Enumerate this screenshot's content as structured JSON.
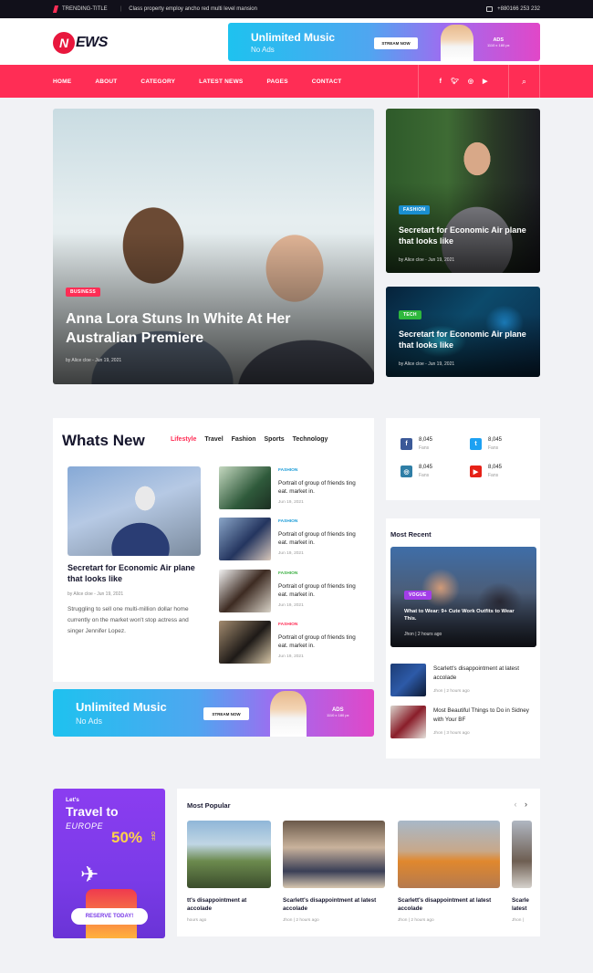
{
  "topbar": {
    "trending_label": "TRENDING-TITLE",
    "trending_text": "Class property employ ancho red multi level mansion",
    "phone": "+880166 253 232"
  },
  "logo": {
    "text": "EWS",
    "initial": "N"
  },
  "header_ad": {
    "title": "Unlimited Music",
    "subtitle": "No Ads",
    "button": "STREAM NOW",
    "ads_label": "ADS",
    "ads_size": "1110 x 180 px"
  },
  "nav": {
    "items": [
      "HOME",
      "ABOUT",
      "CATEGORY",
      "LATEST NEWS",
      "PAGES",
      "CONTACT"
    ],
    "social": [
      "f",
      "t",
      "ig",
      "yt"
    ],
    "search_icon": "search-icon"
  },
  "hero": {
    "main": {
      "badge": "BUSINESS",
      "title": "Anna Lora Stuns In White At Her Australian Premiere",
      "meta": "by Alice cloe - Jun 19, 2021"
    },
    "right1": {
      "badge": "FASHION",
      "title": "Secretart for Economic Air plane that looks like",
      "meta": "by Alice cloe - Jun 19, 2021"
    },
    "right2": {
      "badge": "TECH",
      "title": "Secretart for Economic Air plane that looks like",
      "meta": "by Alice cloe - Jun 19, 2021"
    }
  },
  "whats_new": {
    "heading": "Whats New",
    "tabs": [
      "Lifestyle",
      "Travel",
      "Fashion",
      "Sports",
      "Technology"
    ],
    "featured": {
      "title": "Secretart for Economic Air plane that looks like",
      "meta": "by Alice cloe - Jun 19, 2021",
      "excerpt": "Struggling to sell one multi-million dollar home currently on the market won't stop actress and singer Jennifer Lopez."
    },
    "items": [
      {
        "category": "FASHION",
        "title": "Portrait of group of friends ting eat. market in.",
        "meta": "Jun 19, 2021",
        "color": "#1a9bd7"
      },
      {
        "category": "FASHION",
        "title": "Portrait of group of friends ting eat. market in.",
        "meta": "Jun 19, 2021",
        "color": "#1a9bd7"
      },
      {
        "category": "FASHION",
        "title": "Portrait of group of friends ting eat. market in.",
        "meta": "Jun 19, 2021",
        "color": "#3cb043"
      },
      {
        "category": "FASHION",
        "title": "Portrait of group of friends ting eat. market in.",
        "meta": "Jun 19, 2021",
        "color": "#ff2d55"
      }
    ]
  },
  "fans": [
    {
      "icon": "facebook-icon",
      "glyph": "f",
      "value": "8,045",
      "label": "Fans",
      "color": "#3b5998"
    },
    {
      "icon": "twitter-icon",
      "glyph": "t",
      "value": "8,045",
      "label": "Fans",
      "color": "#1da1f2"
    },
    {
      "icon": "instagram-icon",
      "glyph": "◎",
      "value": "8,045",
      "label": "Fans",
      "color": "#2f7ea6"
    },
    {
      "icon": "youtube-icon",
      "glyph": "▶",
      "value": "8,045",
      "label": "Fans",
      "color": "#e62117"
    }
  ],
  "most_recent": {
    "heading": "Most Recent",
    "featured": {
      "badge": "VOGUE",
      "title": "What to Wear: 9+ Cute Work Outfits to Wear This.",
      "meta": "Jhon | 2 hours ago"
    },
    "items": [
      {
        "title": "Scarlett's disappointment at latest accolade",
        "meta": "Jhon | 2 hours ago"
      },
      {
        "title": "Most Beautiful Things to Do in Sidney with Your BF",
        "meta": "Jhon | 3 hours ago"
      }
    ]
  },
  "mid_ad": {
    "title": "Unlimited Music",
    "subtitle": "No Ads",
    "button": "STREAM NOW",
    "ads_label": "ADS",
    "ads_size": "1110 x 180 px"
  },
  "promo": {
    "lets": "Let's",
    "travel": "Travel to",
    "europe": "EUROPE",
    "percent": "50%",
    "off": "OFF",
    "button": "RESERVE TODAY!"
  },
  "most_popular": {
    "heading": "Most Popular",
    "prev": "‹",
    "next": "›",
    "items": [
      {
        "title": "tt's disappointment at accolade",
        "meta": "hours ago"
      },
      {
        "title": "Scarlett's disappointment at latest accolade",
        "meta": "Jhon | 2 hours ago"
      },
      {
        "title": "Scarlett's disappointment at latest accolade",
        "meta": "Jhon | 2 hours ago"
      },
      {
        "title": "Scarle latest",
        "meta": "Jhon |"
      }
    ]
  }
}
